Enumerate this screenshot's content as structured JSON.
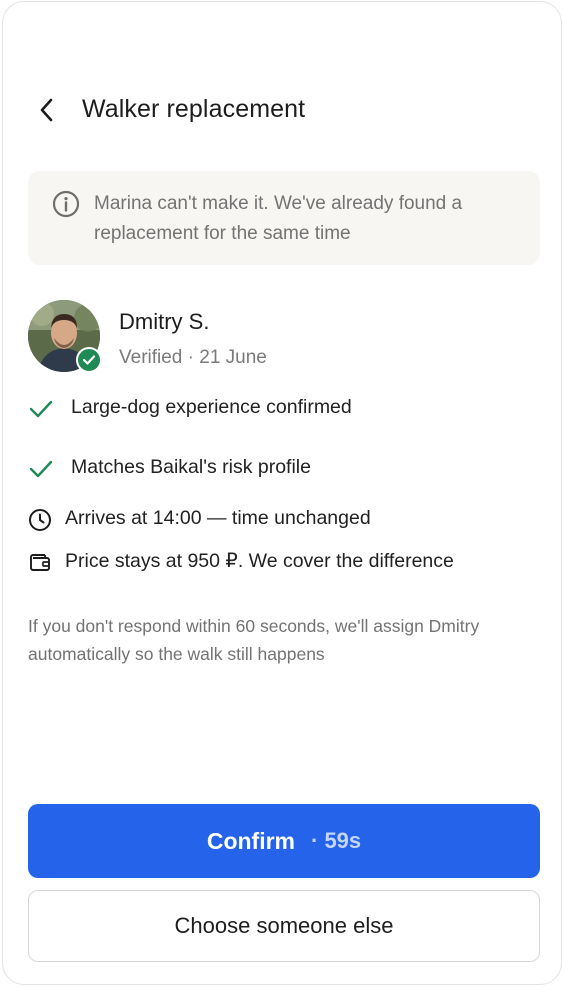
{
  "header": {
    "back_icon": "chevron-left-icon",
    "title": "Walker replacement"
  },
  "notice": {
    "icon": "info-icon",
    "text": "Marina can't make it. We've already found a replacement for the same time"
  },
  "walker": {
    "name": "Dmitry S.",
    "meta": "Verified · 21 June",
    "badge_icon": "check-badge-icon"
  },
  "features": [
    {
      "icon": "check-icon",
      "text": "Large-dog experience confirmed"
    },
    {
      "icon": "check-icon",
      "text": "Matches Baikal's risk profile"
    },
    {
      "icon": "clock-icon",
      "text": "Arrives at 14:00 — time unchanged"
    },
    {
      "icon": "wallet-icon",
      "text": "Price stays at 950 ₽. We cover the difference"
    }
  ],
  "footnote": "If you don't respond within 60 seconds, we'll assign Dmitry automatically so the walk still happens",
  "actions": {
    "confirm_label": "Confirm",
    "confirm_timer": "· 59s",
    "alternative_label": "Choose someone else"
  },
  "colors": {
    "accent": "#2563eb",
    "success": "#1f8a55",
    "notice_bg": "#f8f6f3"
  }
}
